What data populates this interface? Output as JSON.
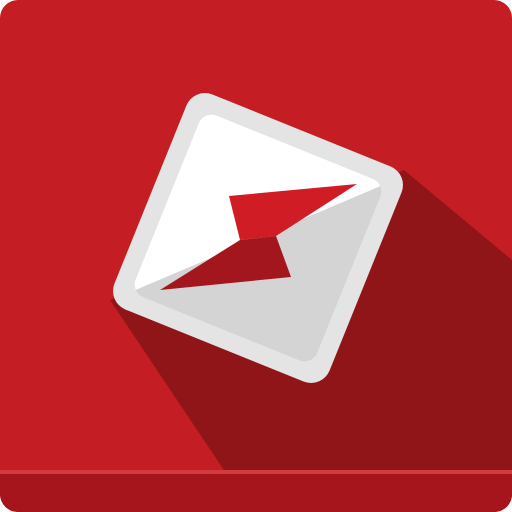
{
  "icon": {
    "name": "app-icon",
    "glyph": "lightning-bolt-tile-icon",
    "colors": {
      "background": "#c41e24",
      "base_band": "#a5151b",
      "base_highlight": "#d33a3f",
      "long_shadow": "#8f1519",
      "tile_rim": "#e4e4e4",
      "tile_white": "#ffffff",
      "tile_grey": "#d4d4d4",
      "bolt_red": "#d01c24",
      "bolt_dark": "#a3161d"
    }
  }
}
